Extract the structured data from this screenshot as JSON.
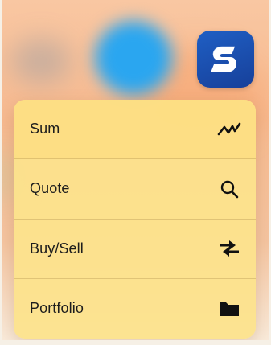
{
  "app_icon": {
    "icon": "s-logo-icon",
    "color_start": "#1f5fc4",
    "color_end": "#17409a"
  },
  "menu": {
    "items": [
      {
        "label": "Sum",
        "icon": "chart-line-icon"
      },
      {
        "label": "Quote",
        "icon": "search-icon"
      },
      {
        "label": "Buy/Sell",
        "icon": "swap-arrows-icon"
      },
      {
        "label": "Portfolio",
        "icon": "folder-icon"
      }
    ],
    "background": "#fce28c"
  }
}
